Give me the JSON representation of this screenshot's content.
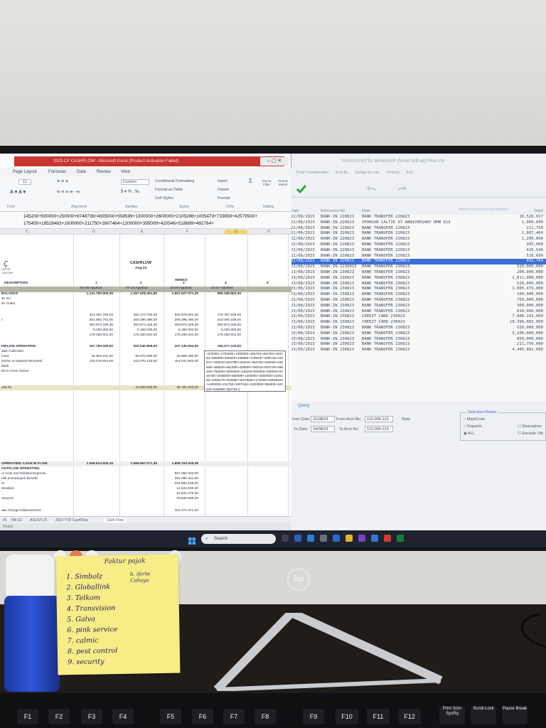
{
  "excel": {
    "window_title": "2023 CF CASHFLOW - Microsoft Excel (Product Activation Failed)",
    "tabs": [
      "Page Layout",
      "Formulas",
      "Data",
      "Review",
      "View"
    ],
    "ribbon": {
      "font_size": "11",
      "number_format": "Custom",
      "conditional_formatting": "Conditional Formatting",
      "format_as_table": "Format as Table",
      "cell_styles": "Cell Styles",
      "insert": "Insert",
      "delete": "Delete",
      "format": "Format",
      "sort_filter": "Sort & Filter",
      "find_select": "Find & Select",
      "groups": [
        "Font",
        "Alignment",
        "Number",
        "Styles",
        "Cells",
        "Editing"
      ]
    },
    "formula_line1": "145200+500000+250000+8748736+4935000+558599+1300000+2600000+2105286+1005479+733659+42579500+",
    "formula_line2": "175450+18528463+1000000+211750+2807464+1200000+395009+420546+518699+492764+",
    "columns": [
      "C",
      "D",
      "E",
      "F",
      "G",
      "H"
    ],
    "sheet": {
      "title": "CASHFLOW",
      "month": "Aug-23",
      "logo_text": "HOTEL CAESAR",
      "weeks_label": "WEEKS",
      "description_label": "DESCRIPTION",
      "week_numbers": [
        "1",
        "2",
        "3",
        "4",
        "5"
      ],
      "week_ranges": [
        "01-06 Agustus",
        "07-13 Agustus",
        "14-20 Agustus",
        "21-27 Agustus"
      ],
      "rows": [
        {
          "label": "BALANCE",
          "values": [
            "1.141.790.500,35",
            "1.257.928.361,95",
            "1.601.627.071,35",
            "989.168.663,35"
          ]
        },
        {
          "label": "sh GC",
          "values": [
            "",
            "",
            "",
            ""
          ]
        },
        {
          "label": "sh Outlet",
          "values": [
            "",
            "",
            "",
            ""
          ]
        },
        {
          "label": "",
          "values": [
            "314.391.768,00",
            "482.174.793,00",
            "825.875.601,00",
            "170.767.535,00"
          ]
        },
        {
          "label": "t",
          "values": [
            "251.983.752,00",
            "200.396.490,00",
            "200.396.490,00",
            "243.046.168,00"
          ]
        },
        {
          "label": "",
          "values": [
            "393.874.349,35",
            "393.874.349,35",
            "393.874.349,35",
            "393.874.349,35"
          ]
        },
        {
          "label": "",
          "values": [
            "5.150.000,00",
            "5.150.000,00",
            "5.150.000,00",
            "5.150.000,00"
          ]
        },
        {
          "label": "",
          "values": [
            "176.330.631,00",
            "176.330.631,00",
            "176.330.631,00",
            "176.330.631,00"
          ]
        },
        {
          "label": "INFLOW OPERATING",
          "values": [
            "167.783.025,00",
            "302.040.808,00",
            "207.135.934,00",
            "155.277.102,00"
          ]
        },
        {
          "label": "ales Collection",
          "values": [
            "",
            "",
            "",
            ""
          ]
        },
        {
          "label": "Card",
          "values": [
            "34.303.181,00",
            "59.970.655,00",
            "42.588.380,00",
            "44.447.090,00"
          ]
        },
        {
          "label": "lection & Deposit Received",
          "values": [
            "133.479.844,00",
            "242.070.153,00",
            "164.547.554,00",
            ""
          ]
        },
        {
          "label": "bank",
          "values": [
            "",
            "",
            "",
            ""
          ]
        },
        {
          "label": "fer In From Owner",
          "values": [
            "",
            "",
            "",
            ""
          ]
        }
      ],
      "ok_row": {
        "label": "ook IN",
        "values": [
          "",
          "41.660.000,00",
          "38.781.000,00",
          ""
        ]
      },
      "net_row": {
        "label": "OPERATING CASH IN FLOW",
        "values": [
          "1.309.513.525,35",
          "1.559.967.071,35",
          "1.808.763.005,35",
          ""
        ]
      },
      "outflow_label": "OUTFLOW OPERATING",
      "outflow_rows": [
        {
          "label": "ur Cost and Related Expense",
          "value": "827.350.322,00"
        },
        {
          "label": "nsll & Employee Benefit",
          "value": "292.086.321,00"
        },
        {
          "label": "el",
          "value": "234.560.158,00"
        },
        {
          "label": "esoskes",
          "value": "14.844.000,00"
        },
        {
          "label": "",
          "value": "21.841.575,00"
        },
        {
          "label": "esource",
          "value": "20.840.588,00"
        },
        {
          "label": "ake Charge Disbursement",
          "value": "164.274.371,00"
        },
        {
          "label": "ax - PB 1",
          "value": "192.127.727,00"
        },
        {
          "label": "ajak Parkir",
          "value": "160.823.840,00"
        },
        {
          "label": "BB",
          "value": "600.000,00"
        },
        {
          "label": "ax - PPh 23",
          "value": ""
        },
        {
          "label": "PH",
          "value": "30.703.887,00"
        },
        {
          "label": "perational",
          "value": "94.206.719,00"
        },
        {
          "label": "Food & Beverage",
          "value": ""
        },
        {
          "label": "General Supplies",
          "value": ""
        },
        {
          "label": "House Bank GC Operational",
          "value": ""
        },
        {
          "label": "References",
          "value": ""
        }
      ],
      "popup_text": "+378491+1793206+1000000+484784+484784+484784+395009+466829+438899+1795497+909718+448874+430919+822798+430919+484784+530669+530669+466829+861839+438899+790019+502739+296450+750000+3000000+145200+500000+250000+8748736+4935000+558599+1300000+2600000+2105286+1005479+333659+42579500+175450+18528463+1000000+211750+2807464+1200000+395009+420546+518699+492764+|"
    },
    "sheet_tabs": [
      "IN",
      "HB GC",
      "AGUSTUS",
      "2023 YTD CashFlow",
      "Cash Flow"
    ],
    "status": "Ready"
  },
  "bank": {
    "window_title": "YASAKA HOTEL MANAGER (Small Softcap) Price Ltd",
    "menu": [
      "Find Formalization",
      "Sort By",
      "Design by Ltd.",
      "Find by",
      "Exit"
    ],
    "header_note": "Normal List by Account Number",
    "columns": [
      "Date",
      "Reference-No",
      "Note",
      "Debit"
    ],
    "rows": [
      {
        "date": "22/08/2023",
        "ref": "BANK-IN 220823",
        "note": "BANK TRANSFER 220823",
        "amount": "10,526,917"
      },
      {
        "date": "22/08/2023",
        "ref": "BANK-IN 220823",
        "note": "SPONSOR CALTIE 97 ANNIVERSARY HMM 613",
        "amount": "1,000,000"
      },
      {
        "date": "22/08/2023",
        "ref": "BANK-IN 220823",
        "note": "BANK TRANSFER 220823",
        "amount": "211,750"
      },
      {
        "date": "22/08/2023",
        "ref": "BANK-IN 220823",
        "note": "BANK TRANSFER 220823",
        "amount": "2,807,464"
      },
      {
        "date": "22/08/2023",
        "ref": "BANK-IN 220823",
        "note": "BANK TRANSFER 220823",
        "amount": "1,200,000"
      },
      {
        "date": "22/08/2023",
        "ref": "BANK-IN 220823",
        "note": "BANK TRANSFER 220823",
        "amount": "395,009"
      },
      {
        "date": "22/08/2023",
        "ref": "BANK-IN 220823",
        "note": "BANK TRANSFER 220823",
        "amount": "420,546"
      },
      {
        "date": "22/08/2023",
        "ref": "BANK-IN 220823",
        "note": "BANK TRANSFER 220823",
        "amount": "518,699"
      },
      {
        "date": "22/08/2023",
        "ref": "BANK-IN 220823",
        "note": "BANK TRANSFER 220823",
        "amount": "492,764",
        "selected": true
      },
      {
        "date": "23/08/2023",
        "ref": "BANK-IN 1230823",
        "note": "BANK TRANSFER 230823",
        "amount": "520,000,000"
      },
      {
        "date": "23/08/2023",
        "ref": "BANK-IN 230823",
        "note": "BANK TRANSFER 230823",
        "amount": "200,000,000"
      },
      {
        "date": "23/08/2023",
        "ref": "BANK-IN 230823",
        "note": "BANK TRANSFER 230823",
        "amount": "1,011,000,000"
      },
      {
        "date": "23/08/2023",
        "ref": "BANK-IN 230823",
        "note": "BANK TRANSFER 230823",
        "amount": "520,000,000"
      },
      {
        "date": "23/08/2023",
        "ref": "BANK-IN 230823",
        "note": "BANK TRANSFER 230823",
        "amount": "1,005,479,000"
      },
      {
        "date": "23/08/2023",
        "ref": "BANK-IN 230823",
        "note": "BANK TRANSFER 230823",
        "amount": "100,000,000"
      },
      {
        "date": "23/08/2023",
        "ref": "BANK-IN 230823",
        "note": "BANK TRANSFER 230823",
        "amount": "750,000,000"
      },
      {
        "date": "23/08/2023",
        "ref": "BANK-IN 230823",
        "note": "BANK TRANSFER 230823",
        "amount": "300,000,000"
      },
      {
        "date": "23/08/2023",
        "ref": "BANK-IN 230823",
        "note": "BANK TRANSFER 230823",
        "amount": "630,000,000"
      },
      {
        "date": "23/08/2023",
        "ref": "BANK-IN 230823",
        "note": "CREDIT CARD 230823",
        "amount": "7,900,193,000"
      },
      {
        "date": "23/08/2023",
        "ref": "BANK-IN 230823",
        "note": "CREDIT CARD 230823",
        "amount": "10,396,083,000"
      },
      {
        "date": "23/08/2023",
        "ref": "BANK-IN 230823",
        "note": "BANK TRANSFER 230823",
        "amount": "520,000,000"
      },
      {
        "date": "23/08/2023",
        "ref": "BANK-IN 230823",
        "note": "BANK TRANSFER 230823",
        "amount": "3,100,000,000"
      },
      {
        "date": "23/08/2023",
        "ref": "BANK-IN 230823",
        "note": "BANK TRANSFER 230823",
        "amount": "850,000,000"
      },
      {
        "date": "23/08/2023",
        "ref": "BANK-IN 230823",
        "note": "BANK TRANSFER 230823",
        "amount": "211,750,000"
      },
      {
        "date": "23/08/2023",
        "ref": "BANK-IN 230823",
        "note": "BANK TRANSFER 230823",
        "amount": "4,445,881,000"
      }
    ],
    "query": {
      "label": "Query",
      "from_date_label": "From Date:",
      "from_date": "21/08/23",
      "from_acct_label": "From Acct-No:",
      "from_acct": "112-000-123",
      "note_label": "Note:",
      "to_date_label": "To Date:",
      "to_date": "24/08/23",
      "to_acct_label": "To Acct-No:",
      "to_acct": "112-000-123",
      "selection_modes_label": "Selection Modes",
      "modes": [
        "MainCode",
        "Departm",
        "ALL"
      ],
      "selected_mode": "ALL",
      "description_option": "Description",
      "exclude_option": "Exclude Oth"
    }
  },
  "taskbar": {
    "search_placeholder": "Search"
  },
  "monitor_brand": "hp",
  "sticky_note": {
    "title": "Faktur pajak",
    "side_note": "b. iforte\nCahaya",
    "items": [
      "1. Simbolz",
      "2. Globallink",
      "3. Telkom",
      "4. Transvision",
      "5. Galva",
      "6. pink service",
      "7. calmic",
      "8. pest control",
      "9. security"
    ]
  },
  "keyboard": {
    "keys": [
      "F1",
      "F2",
      "F3",
      "F4",
      "F5",
      "F6",
      "F7",
      "F8",
      "F9",
      "F10",
      "F11",
      "F12"
    ],
    "special_keys": [
      "Print Scrn SysRq",
      "Scroll Lock",
      "Pause Break"
    ]
  },
  "colors": {
    "excel_title_bar": "#c8342f",
    "selected_row": "#3d6fd8",
    "sticky_note": "#f7ec86",
    "bottle": "#2f55d8"
  }
}
